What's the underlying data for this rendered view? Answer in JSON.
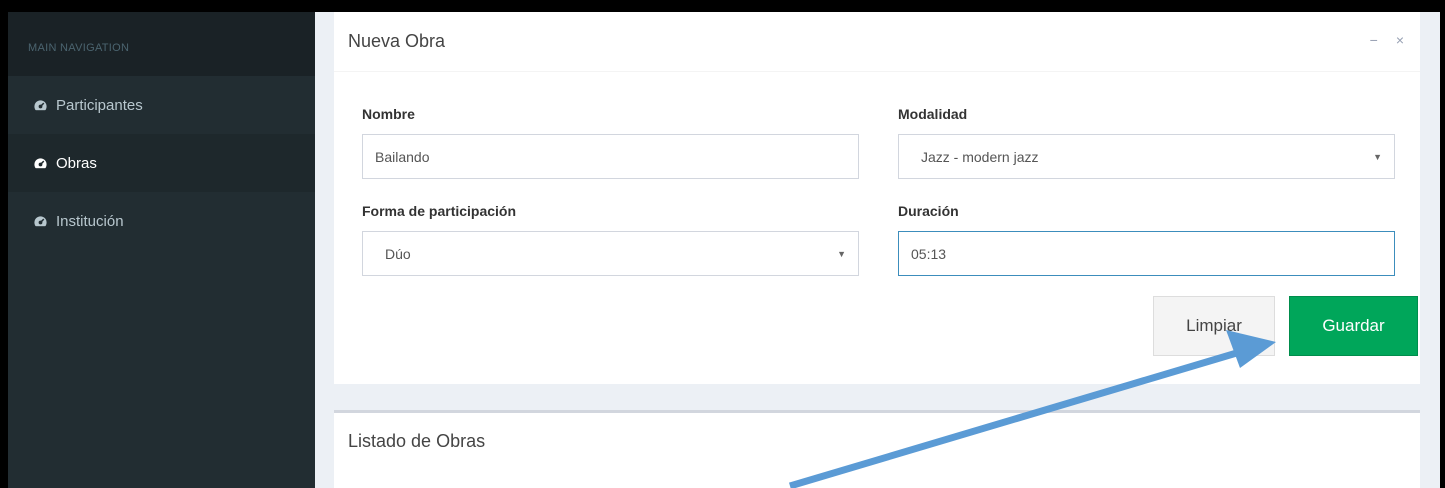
{
  "sidebar": {
    "header": "MAIN NAVIGATION",
    "items": [
      {
        "label": "Participantes",
        "icon": "dashboard-icon"
      },
      {
        "label": "Obras",
        "icon": "dashboard-icon",
        "active": true
      },
      {
        "label": "Institución",
        "icon": "dashboard-icon"
      }
    ]
  },
  "form_box": {
    "title": "Nueva Obra",
    "tools": {
      "minimize": "−",
      "close": "×"
    },
    "fields": {
      "nombre": {
        "label": "Nombre",
        "value": "Bailando"
      },
      "modalidad": {
        "label": "Modalidad",
        "value": "Jazz - modern jazz"
      },
      "forma": {
        "label": "Forma de participación",
        "value": "Dúo"
      },
      "duracion": {
        "label": "Duración",
        "value": "05:13"
      }
    },
    "buttons": {
      "clear": "Limpiar",
      "save": "Guardar"
    }
  },
  "list_box": {
    "title": "Listado de Obras"
  },
  "colors": {
    "sidebar": "#222d32",
    "success": "#00a65a",
    "annotation_arrow": "#5b9bd5"
  }
}
